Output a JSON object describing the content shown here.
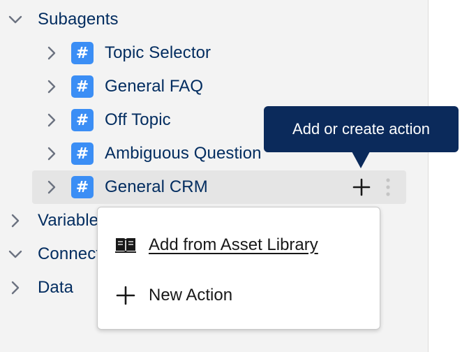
{
  "tree": {
    "subagents": {
      "label": "Subagents",
      "children": [
        {
          "label": "Topic Selector",
          "icon": "hash-icon"
        },
        {
          "label": "General FAQ",
          "icon": "hash-icon"
        },
        {
          "label": "Off Topic",
          "icon": "hash-icon"
        },
        {
          "label": "Ambiguous Question",
          "icon": "hash-icon"
        },
        {
          "label": "General CRM",
          "icon": "hash-icon",
          "selected": true
        }
      ]
    },
    "variables": {
      "label": "Variables"
    },
    "connections": {
      "label": "Connections"
    },
    "data": {
      "label": "Data"
    }
  },
  "tooltip": {
    "text": "Add or create action"
  },
  "menu": {
    "items": [
      {
        "label": "Add from Asset Library",
        "icon": "book-icon"
      },
      {
        "label": "New Action",
        "icon": "plus-icon"
      }
    ]
  },
  "colors": {
    "panel_bg": "#f3f3f3",
    "text": "#032d60",
    "hash_icon_bg": "#3b8ef5",
    "selected_row_bg": "#e5e5e5",
    "tooltip_bg": "#0b2a5b"
  }
}
